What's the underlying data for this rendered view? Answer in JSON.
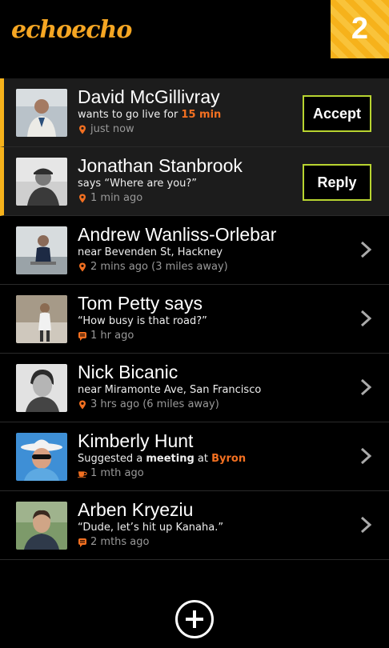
{
  "app": {
    "logo": "echoecho",
    "notification_count": "2"
  },
  "colors": {
    "accent": "#f37021",
    "badge": "#f6b21b",
    "button_border": "#b8d430"
  },
  "items": [
    {
      "name": "David McGillivray",
      "sub_pre": "wants to go live for ",
      "sub_accent": "15 min",
      "meta_icon": "location-pin-icon",
      "meta": "just now",
      "action": "Accept"
    },
    {
      "name": "Jonathan Stanbrook",
      "sub": "says “Where are you?”",
      "meta_icon": "location-pin-icon",
      "meta": "1 min ago",
      "action": "Reply"
    },
    {
      "name": "Andrew Wanliss-Orlebar",
      "sub": "near Bevenden St, Hackney",
      "meta_icon": "location-pin-icon",
      "meta": "2 mins ago (3 miles away)"
    },
    {
      "name": "Tom Petty",
      "name_suffix": " says",
      "sub": "“How busy is that road?”",
      "meta_icon": "chat-icon",
      "meta": "1 hr ago"
    },
    {
      "name": "Nick Bicanic",
      "sub": "near Miramonte Ave, San Francisco",
      "meta_icon": "location-pin-icon",
      "meta": "3 hrs ago (6 miles away)"
    },
    {
      "name": "Kimberly Hunt",
      "sub_pre": "Suggested a ",
      "sub_bold": "meeting",
      "sub_mid": " at ",
      "sub_accent": "Byron",
      "meta_icon": "coffee-cup-icon",
      "meta": "1 mth ago"
    },
    {
      "name": "Arben Kryeziu",
      "sub": "“Dude, let’s hit up Kanaha.”",
      "meta_icon": "chat-icon",
      "meta": "2 mths ago"
    }
  ]
}
